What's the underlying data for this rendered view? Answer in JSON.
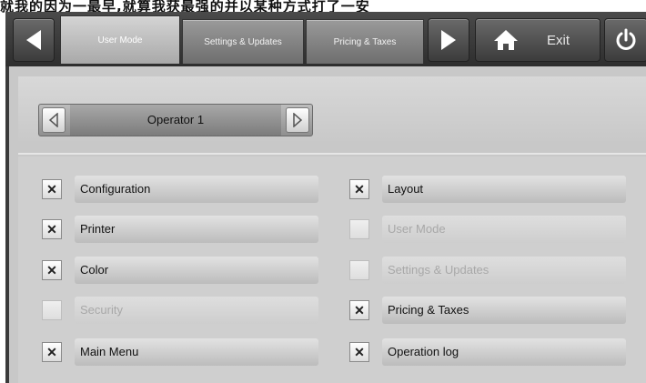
{
  "caption": "就我的因为一最早,就算我获最强的并以某种方式打了一安",
  "topbar": {
    "tabs": [
      {
        "label": "User Mode",
        "active": true
      },
      {
        "label": "Settings & Updates",
        "active": false
      },
      {
        "label": "Pricing & Taxes",
        "active": false
      }
    ],
    "exit_label": "Exit"
  },
  "operator": {
    "selected": "Operator 1"
  },
  "permissions": {
    "left": [
      {
        "label": "Configuration",
        "checked": true,
        "enabled": true
      },
      {
        "label": "Printer",
        "checked": true,
        "enabled": true
      },
      {
        "label": "Color",
        "checked": true,
        "enabled": true
      },
      {
        "label": "Security",
        "checked": false,
        "enabled": false
      },
      {
        "label": "Main Menu",
        "checked": true,
        "enabled": true
      }
    ],
    "right": [
      {
        "label": "Layout",
        "checked": true,
        "enabled": true
      },
      {
        "label": "User Mode",
        "checked": false,
        "enabled": false
      },
      {
        "label": "Settings & Updates",
        "checked": false,
        "enabled": false
      },
      {
        "label": "Pricing & Taxes",
        "checked": true,
        "enabled": true
      },
      {
        "label": "Operation log",
        "checked": true,
        "enabled": true
      }
    ]
  },
  "check_glyph": "✕"
}
